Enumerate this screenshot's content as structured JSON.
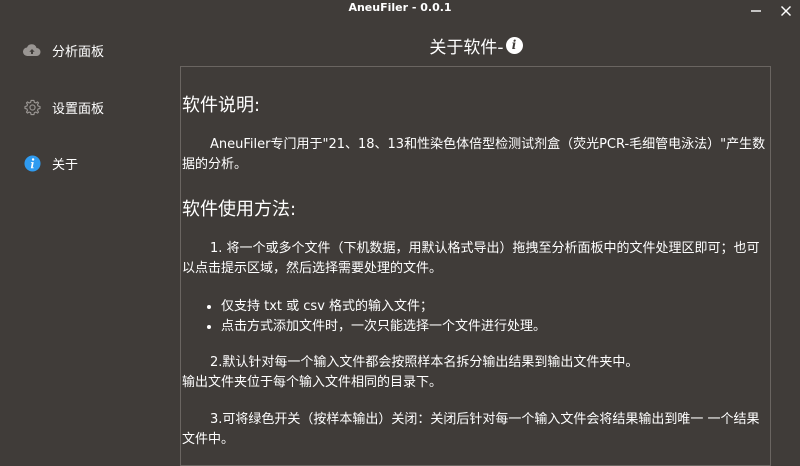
{
  "window": {
    "title": "AneuFiler - 0.0.1",
    "minimize_glyph": "—",
    "close_glyph": "✕"
  },
  "sidebar": {
    "items": [
      {
        "label": "分析面板",
        "icon": "cloud-upload-icon"
      },
      {
        "label": "设置面板",
        "icon": "gear-icon"
      },
      {
        "label": "关于",
        "icon": "info-icon"
      }
    ]
  },
  "main": {
    "title": "关于软件-",
    "title_icon_glyph": "i",
    "sections": {
      "desc_heading": "软件说明:",
      "desc_text": "AneuFiler专门用于\"21、18、13和性染色体倍型检测试剂盒（荧光PCR-毛细管电泳法）\"产生数据的分析。",
      "usage_heading": "软件使用方法:",
      "step1": "1. 将一个或多个文件（下机数据，用默认格式导出）拖拽至分析面板中的文件处理区即可；也可以点击提示区域，然后选择需要处理的文件。",
      "bullets": [
        "仅支持 txt 或 csv 格式的输入文件；",
        "点击方式添加文件时，一次只能选择一个文件进行处理。"
      ],
      "step2_line1": "2.默认针对每一个输入文件都会按照样本名拆分输出结果到输出文件夹中。",
      "step2_line2": "输出文件夹位于每个输入文件相同的目录下。",
      "step3": "3.可将绿色开关（按样本输出）关闭：关闭后针对每一个输入文件会将结果输出到唯一 一个结果文件中。"
    }
  },
  "colors": {
    "background": "#403c39",
    "text": "#ffffff",
    "border": "#6a6561",
    "accent_blue": "#2f9bf0"
  }
}
